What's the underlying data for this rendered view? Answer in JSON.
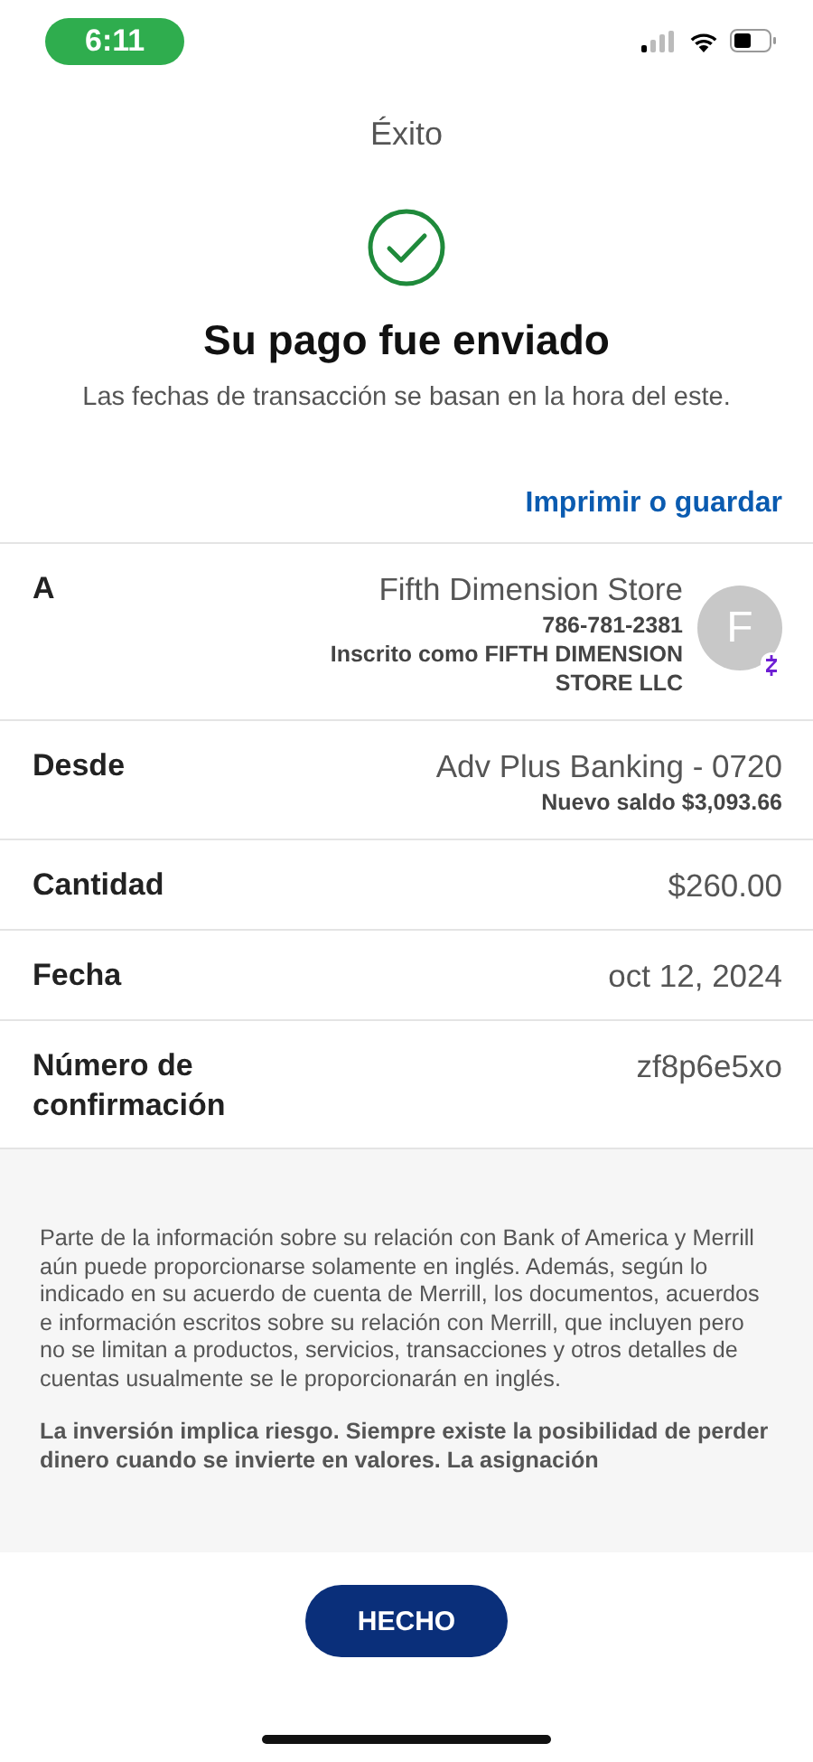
{
  "status_bar": {
    "time": "6:11"
  },
  "header": {
    "title": "Éxito"
  },
  "confirmation": {
    "headline": "Su pago fue enviado",
    "note": "Las fechas de transacción se basan en la hora del este."
  },
  "print_link": "Imprimir o guardar",
  "details": [
    {
      "kind": "recipient",
      "label": "A",
      "value": "Fifth Dimension Store",
      "lines": [
        "786-781-2381",
        "Inscrito como FIFTH DIMENSION STORE LLC"
      ],
      "avatar": "F"
    },
    {
      "kind": "value",
      "label": "Desde",
      "value": "Adv Plus Banking - 0720",
      "lines": [
        "Nuevo saldo $3,093.66"
      ]
    },
    {
      "kind": "value",
      "label": "Cantidad",
      "value": "$260.00"
    },
    {
      "kind": "value",
      "label": "Fecha",
      "value": "oct 12, 2024"
    },
    {
      "kind": "value",
      "label": "Número de confirmación",
      "value": "zf8p6e5xo"
    }
  ],
  "disclosures": [
    {
      "kind": "plain",
      "text": "Parte de la información sobre su relación con Bank of America y Merrill aún puede proporcionarse solamente en inglés. Además, según lo indicado en su acuerdo de cuenta de Merrill, los documentos, acuerdos e información escritos sobre su relación con Merrill, que incluyen pero no se limitan a productos, servicios, transacciones y otros detalles de cuentas usualmente se le proporcionarán en inglés."
    },
    {
      "kind": "bold",
      "text": "La inversión implica riesgo. Siempre existe la posibilidad de perder dinero cuando se invierte en valores. La asignación"
    }
  ],
  "done_button": "HECHO"
}
